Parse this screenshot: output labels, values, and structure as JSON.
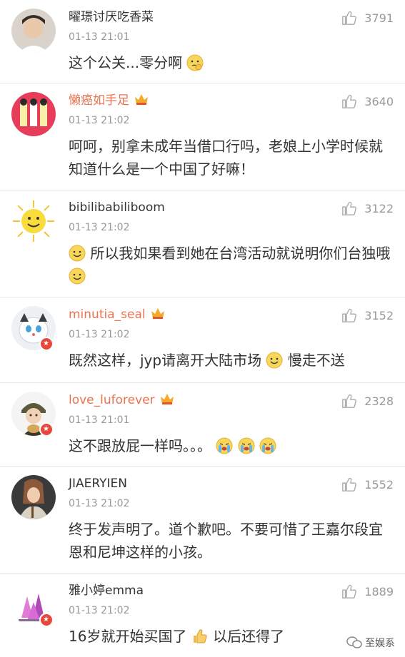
{
  "comments": [
    {
      "username": "曜璟讨厌吃香菜",
      "time": "01-13 21:01",
      "likes": "3791",
      "text": "这个公关...零分啊",
      "vip": false
    },
    {
      "username": "懒癌如手足",
      "time": "01-13 21:02",
      "likes": "3640",
      "text": "呵呵，别拿未成年当借口行吗，老娘上小学时候就知道什么是一个中国了好嘛！",
      "vip": true
    },
    {
      "username": "bibilibabiliboom",
      "time": "01-13 21:02",
      "likes": "3122",
      "text_a": "所以我如果看到她在台湾活动就说明你们台独哦",
      "vip": false
    },
    {
      "username": "minutia_seal",
      "time": "01-13 21:02",
      "likes": "3152",
      "text_a": "既然这样，jyp请离开大陆市场",
      "text_b": "慢走不送",
      "vip": true
    },
    {
      "username": "love_luforever",
      "time": "01-13 21:01",
      "likes": "2328",
      "text": "这不跟放屁一样吗。。。",
      "vip": true
    },
    {
      "username": "JIAERYIEN",
      "time": "01-13 21:02",
      "likes": "1552",
      "text": "终于发声明了。道个歉吧。不要可惜了王嘉尔段宜恩和尼坤这样的小孩。",
      "vip": false
    },
    {
      "username": "雅小婷emma",
      "time": "01-13 21:02",
      "likes": "1889",
      "text_a": "16岁就开始买国了",
      "text_b": "以后还得了",
      "vip": false
    }
  ],
  "watermark": {
    "label": "至娱系"
  }
}
